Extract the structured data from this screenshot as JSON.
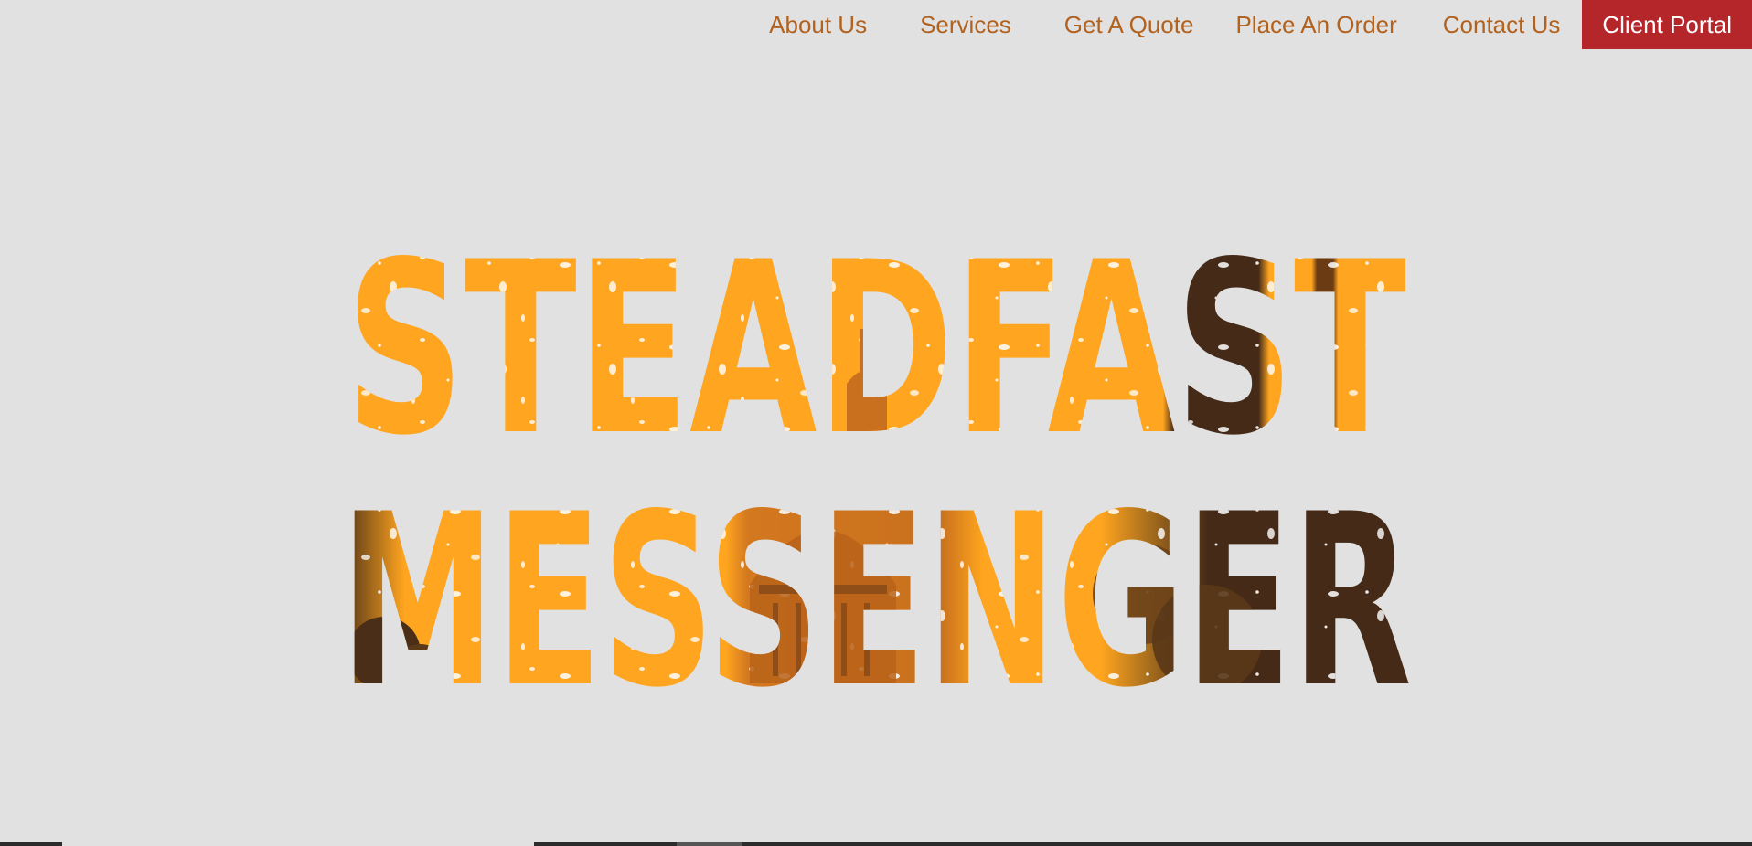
{
  "nav": {
    "about": "About Us",
    "services": "Services",
    "quote": "Get A Quote",
    "order": "Place An Order",
    "contact": "Contact Us",
    "portal": "Client Portal"
  },
  "hero": {
    "line1": "STEADFAST",
    "line2": "MESSENGER"
  },
  "colors": {
    "background": "#e1e1e1",
    "nav_text": "#b1621f",
    "portal_bg": "#b5262b",
    "logo_orange": "#ffa51f",
    "logo_dark": "#452a18",
    "logo_mid": "#d3781f"
  }
}
